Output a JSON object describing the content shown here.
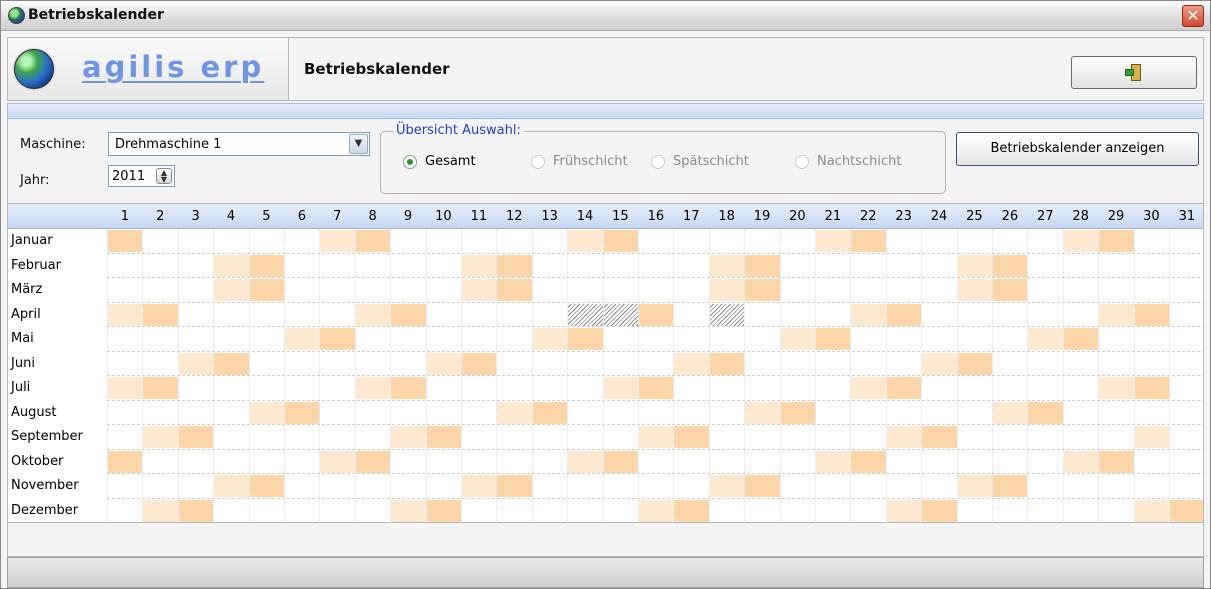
{
  "window": {
    "title": "Betriebskalender",
    "close_symbol": "✕"
  },
  "header": {
    "brand": "agilis erp",
    "title": "Betriebskalender"
  },
  "filter": {
    "maschine_label": "Maschine:",
    "maschine_value": "Drehmaschine 1",
    "jahr_label": "Jahr:",
    "jahr_value": "2011",
    "group_title": "Übersicht Auswahl:",
    "options": [
      {
        "label": "Gesamt",
        "selected": true,
        "enabled": true
      },
      {
        "label": "Frühschicht",
        "selected": false,
        "enabled": false
      },
      {
        "label": "Spätschicht",
        "selected": false,
        "enabled": false
      },
      {
        "label": "Nachtschicht",
        "selected": false,
        "enabled": false
      }
    ],
    "show_button": "Betriebskalender anzeigen"
  },
  "calendar": {
    "days": [
      "1",
      "2",
      "3",
      "4",
      "5",
      "6",
      "7",
      "8",
      "9",
      "10",
      "11",
      "12",
      "13",
      "14",
      "15",
      "16",
      "17",
      "18",
      "19",
      "20",
      "21",
      "22",
      "23",
      "24",
      "25",
      "26",
      "27",
      "28",
      "29",
      "30",
      "31"
    ],
    "months": [
      "Januar",
      "Februar",
      "März",
      "April",
      "Mai",
      "Juni",
      "Juli",
      "August",
      "September",
      "Oktober",
      "November",
      "Dezember"
    ],
    "month_lengths": [
      31,
      28,
      31,
      30,
      31,
      30,
      31,
      31,
      30,
      31,
      30,
      31
    ],
    "first_weekday": [
      6,
      2,
      2,
      5,
      0,
      3,
      5,
      1,
      4,
      6,
      2,
      4
    ],
    "hatched": [
      [
        4,
        14
      ],
      [
        4,
        15
      ],
      [
        4,
        18
      ]
    ],
    "colors": {
      "saturday": "#fde9cf",
      "sunday": "#fcd5a8"
    }
  }
}
